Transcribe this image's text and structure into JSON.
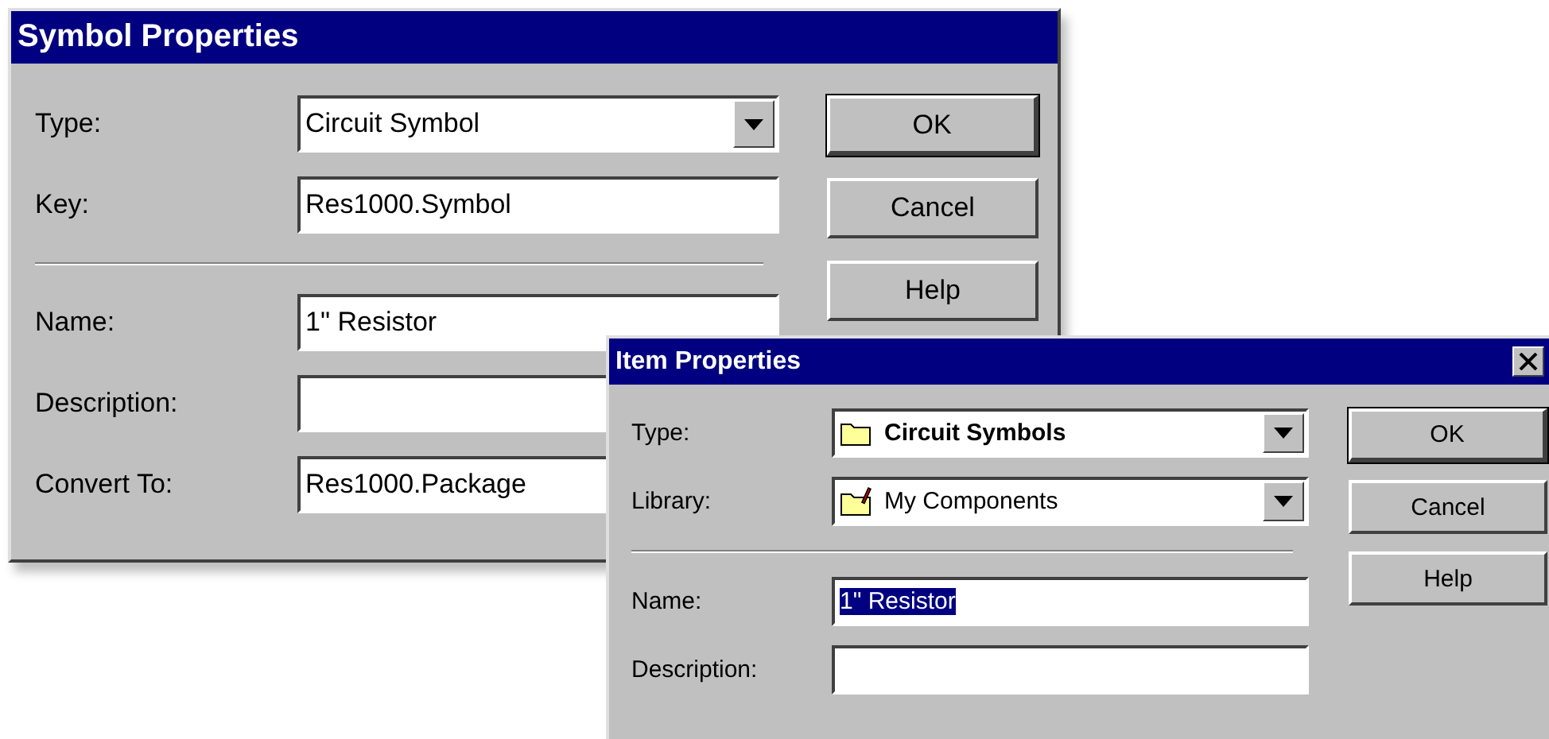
{
  "dialogs": [
    {
      "title": "Symbol Properties",
      "fields": [
        {
          "kind": "combo",
          "label": "Type:",
          "value": "Circuit Symbol"
        },
        {
          "kind": "text",
          "label": "Key:",
          "value": "Res1000.Symbol",
          "text_selected": false
        },
        {
          "kind": "separator"
        },
        {
          "kind": "text",
          "label": "Name:",
          "value": "1\" Resistor",
          "text_selected": false
        },
        {
          "kind": "text",
          "label": "Description:"
        },
        {
          "kind": "text",
          "label": "Convert To:",
          "value": "Res1000.Package",
          "text_selected": false
        }
      ],
      "buttons": [
        {
          "label": "OK",
          "default": true
        },
        {
          "label": "Cancel",
          "default": false
        },
        {
          "label": "Help",
          "default": false
        }
      ]
    },
    {
      "title": "Item Properties",
      "closable": true,
      "fields": [
        {
          "kind": "folder",
          "label": "Type:",
          "value": "Circuit Symbols",
          "bold": true
        },
        {
          "kind": "library",
          "label": "Library:",
          "value": "My Components",
          "bold": false
        },
        {
          "kind": "separator"
        },
        {
          "kind": "text",
          "label": "Name:",
          "value": "1\" Resistor",
          "text_selected": true
        },
        {
          "kind": "text",
          "label": "Description:"
        }
      ],
      "buttons": [
        {
          "label": "OK",
          "default": true
        },
        {
          "label": "Cancel",
          "default": false
        },
        {
          "label": "Help",
          "default": false
        }
      ]
    }
  ]
}
